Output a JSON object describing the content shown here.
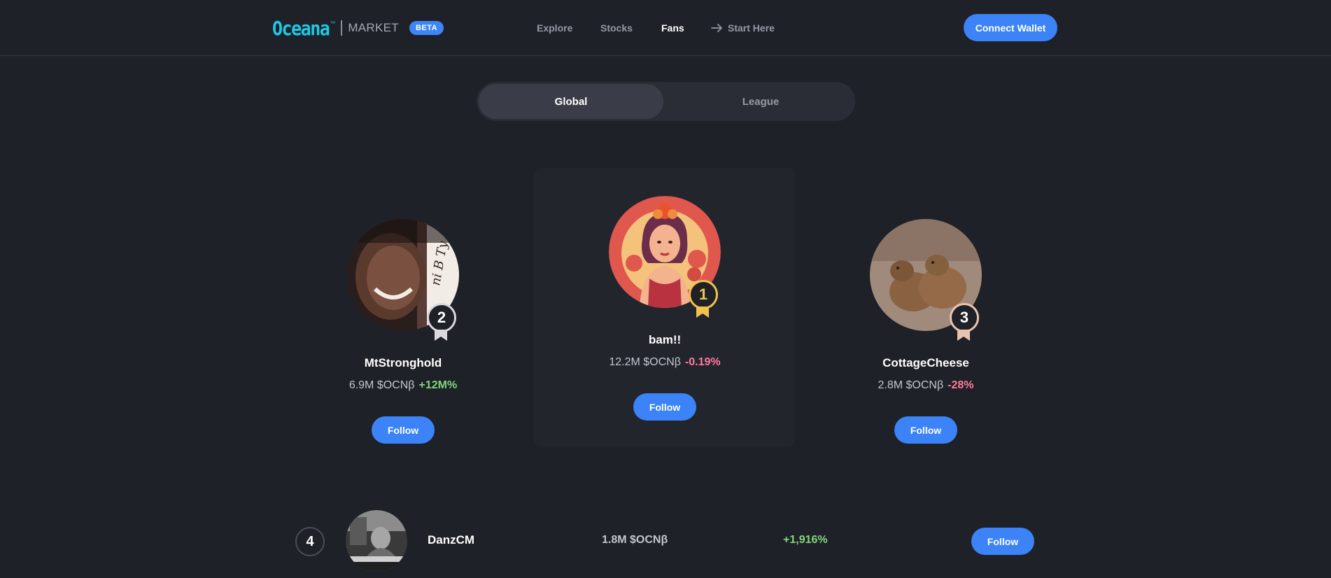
{
  "header": {
    "logo_word": "Oceana",
    "logo_tm": "™",
    "logo_market": "MARKET",
    "beta_badge": "BETA",
    "nav": [
      {
        "label": "Explore",
        "active": false
      },
      {
        "label": "Stocks",
        "active": false
      },
      {
        "label": "Fans",
        "active": true
      },
      {
        "label": "Start Here",
        "active": false,
        "icon": "arrow-right-icon"
      }
    ],
    "connect_wallet": "Connect Wallet"
  },
  "tabs": [
    {
      "label": "Global",
      "active": true
    },
    {
      "label": "League",
      "active": false
    }
  ],
  "podium": [
    {
      "rank": "1",
      "name": "bam!!",
      "balance": "12.2M $OCNβ",
      "change": "-0.19%",
      "change_direction": "down",
      "follow": "Follow",
      "badge_color": "#f2c14e",
      "avatar": "illustrated-woman-portrait"
    },
    {
      "rank": "2",
      "name": "MtStronghold",
      "balance": "6.9M $OCNβ",
      "change": "+12M%",
      "change_direction": "up",
      "follow": "Follow",
      "badge_color": "#d9d9de",
      "avatar": "smiling-person-photo"
    },
    {
      "rank": "3",
      "name": "CottageCheese",
      "balance": "2.8M $OCNβ",
      "change": "-28%",
      "change_direction": "down",
      "follow": "Follow",
      "badge_color": "#e8c3b0",
      "avatar": "capybaras-photo"
    }
  ],
  "list": [
    {
      "rank": "4",
      "name": "DanzCM",
      "balance": "1.8M $OCNβ",
      "change": "+1,916%",
      "change_direction": "up",
      "follow": "Follow",
      "avatar": "grayscale-musician-photo"
    }
  ],
  "colors": {
    "background": "#1f2128",
    "accent_blue": "#3b83f6",
    "logo_cyan": "#1ec7e6",
    "positive": "#7fd77b",
    "negative": "#ff7a9c"
  }
}
